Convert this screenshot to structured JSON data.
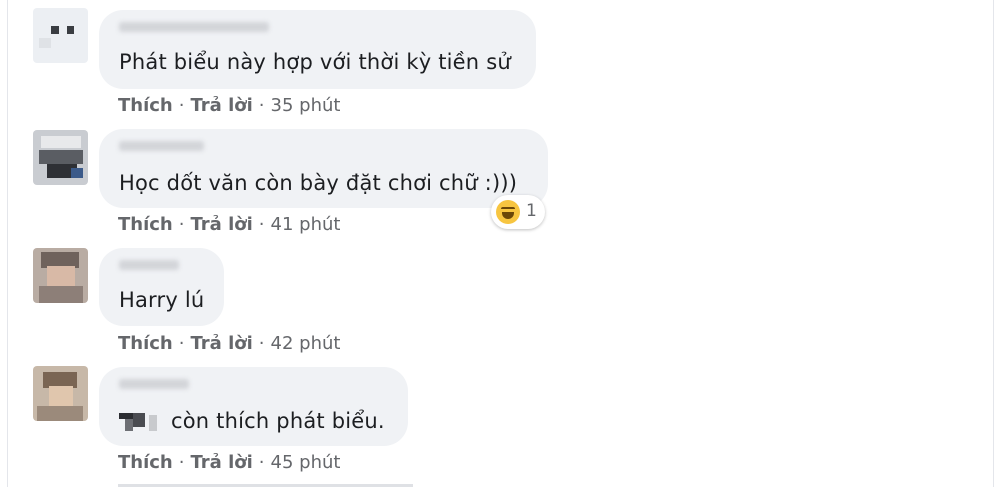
{
  "comments": [
    {
      "text": "Phát biểu này hợp với thời kỳ tiền sử",
      "like": "Thích",
      "reply": "Trả lời",
      "sep": "·",
      "time": "35 phút"
    },
    {
      "text": "Học dốt văn còn bày đặt chơi chữ :)))",
      "like": "Thích",
      "reply": "Trả lời",
      "sep": "·",
      "time": "41 phút",
      "reaction_count": "1"
    },
    {
      "text": "Harry lú",
      "like": "Thích",
      "reply": "Trả lời",
      "sep": "·",
      "time": "42 phút"
    },
    {
      "text": "còn thích phát biểu.",
      "like": "Thích",
      "reply": "Trả lời",
      "sep": "·",
      "time": "45 phút"
    }
  ],
  "colors": {
    "bubble": "#f0f2f5",
    "text": "#1c1e21",
    "meta": "#65676b",
    "reaction": "#f7c540"
  },
  "icons": [
    "laughing-reaction-icon"
  ]
}
